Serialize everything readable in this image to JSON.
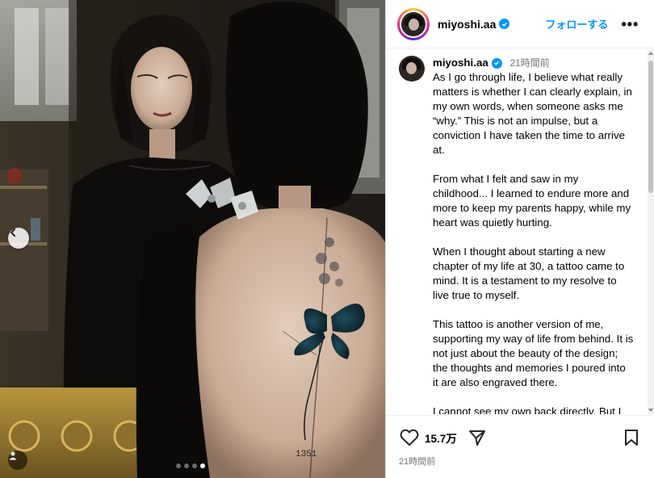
{
  "post": {
    "username": "miyoshi.aa",
    "verified": true,
    "follow_label": "フォローする",
    "more_label": "•••",
    "caption_time": "21時間前",
    "caption_paragraphs": [
      "As I go through life, I believe what really matters is whether I can clearly explain, in my own words, when someone asks me “why.”  This is not an impulse, but a conviction I have taken the time to arrive at.",
      "From what I felt and saw in my childhood... I learned to endure more and more to keep my parents happy, while my heart was quietly hurting.",
      "When I thought about starting a new chapter of my life at 30, a tattoo came to mind. It is a testament to my resolve to live true to myself.",
      "This tattoo is another version of me, supporting my way of life from behind. It is not just about the beauty of the design; the thoughts and memories I poured into it are also engraved there.",
      "I cannot see my own back directly. But I"
    ],
    "likes": "15.7万",
    "post_time": "21時間前"
  },
  "media": {
    "carousel_count": 4,
    "active_index": 3,
    "tattoo_number": "1351"
  },
  "icons": {
    "verified": "verified-badge-icon",
    "like": "heart-icon",
    "share": "paper-plane-icon",
    "save": "bookmark-icon",
    "prev": "chevron-left-icon",
    "tag": "person-tag-icon"
  },
  "colors": {
    "accent": "#0095f6",
    "muted": "#737373",
    "border": "#dbdbdb"
  }
}
